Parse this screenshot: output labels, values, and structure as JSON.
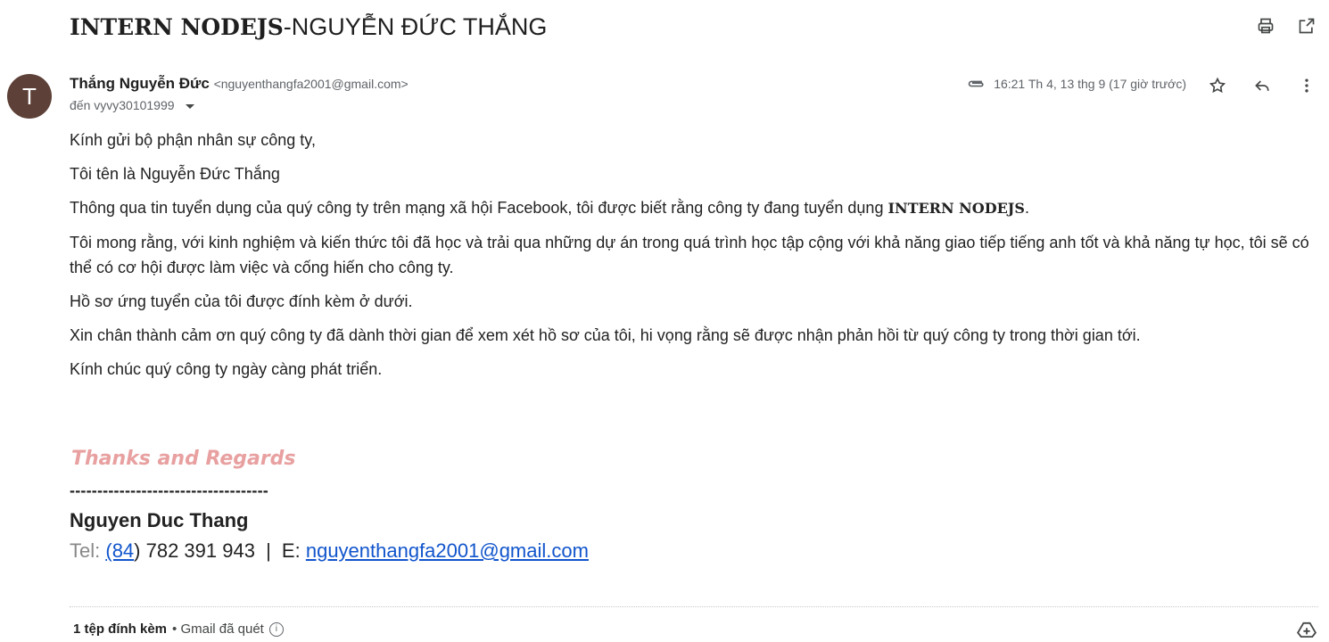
{
  "subject": {
    "bold_part": "INTERN NODEJS",
    "rest": "-NGUYỄN ĐỨC THẮNG"
  },
  "toolbar": {
    "print_icon": "print-icon",
    "open_new_window_icon": "open-in-new-icon"
  },
  "message": {
    "avatar_letter": "T",
    "avatar_color": "#5d4037",
    "sender_name": "Thắng Nguyễn Đức",
    "sender_email": "<nguyenthangfa2001@gmail.com>",
    "recipient": "đến vyvy30101999",
    "timestamp": "16:21 Th 4, 13 thg 9 (17 giờ trước)",
    "actions": {
      "star": "star-icon",
      "reply": "reply-icon",
      "more": "more-vert-icon"
    }
  },
  "body": {
    "greeting": "Kính gửi bộ phận nhân sự công ty,",
    "intro": "Tôi tên là Nguyễn Đức Thắng",
    "para1_pre": "Thông qua tin tuyển dụng của quý công ty trên mạng xã hội Facebook, tôi được biết rằng công ty đang tuyển dụng ",
    "para1_bold": "INTERN NODEJS",
    "para1_post": ".",
    "para2": "Tôi mong rằng, với kinh nghiệm và kiến thức tôi đã học và trải qua những dự án trong quá trình học tập cộng với khả năng giao tiếp tiếng anh tốt và khả năng tự học, tôi sẽ có thể có cơ hội được làm việc và cống hiến cho công ty.",
    "para3": "Hồ sơ ứng tuyển của tôi được đính kèm ở dưới.",
    "para4": "Xin chân thành cảm ơn quý công ty đã dành thời gian để xem xét hồ sơ của tôi, hi vọng rằng sẽ được nhận phản hồi từ quý công ty trong thời gian tới.",
    "closing": "Kính chúc quý công ty ngày càng phát triển."
  },
  "signature": {
    "thanks": "Thanks and Regards",
    "thanks_color": "#e8a0a0",
    "dashes": "------------------------------------",
    "name": "Nguyen Duc Thang",
    "tel_label": "Tel:",
    "tel_code": "(84",
    "tel_rest": ") 782 391 943",
    "separator": "|",
    "email_label": "E:",
    "email": "nguyenthangfa2001@gmail.com",
    "link_color": "#1155cc"
  },
  "attachments": {
    "count_label": "1 tệp đính kèm",
    "scan_label": "• Gmail đã quét",
    "info": "i"
  }
}
